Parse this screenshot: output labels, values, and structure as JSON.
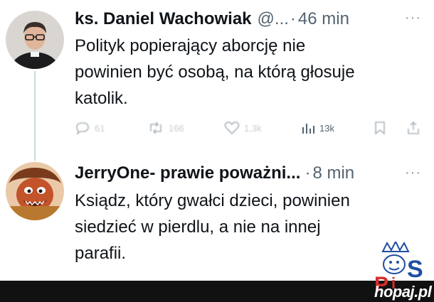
{
  "tweets": [
    {
      "display_name": "ks. Daniel Wachowiak",
      "handle": "@...",
      "separator": "·",
      "time": "46 min",
      "more_label": "···",
      "text_lines": [
        "Polityk popierający aborcję nie",
        "powinien być osobą, na którą głosuje",
        "katolik."
      ],
      "actions": {
        "replies": "61",
        "retweets": "166",
        "likes": "1,3k",
        "views": "13k"
      },
      "avatar_icon": "priest-photo"
    },
    {
      "display_name": "JerryOne- prawie poważni...",
      "separator": "·",
      "time": "8 min",
      "more_label": "···",
      "text_lines": [
        "Ksiądz, który gwałci dzieci, powinien",
        "siedzieć w pierdlu, a nie na innej",
        "parafii."
      ],
      "avatar_icon": "muppet-animal-photo"
    }
  ],
  "watermark": {
    "text": "hopaj.pl",
    "logo_icon": "pis-crown-logo"
  },
  "colors": {
    "text": "#0f1419",
    "secondary": "#536471",
    "thread_line": "#cfd9de",
    "bottom_bar": "#111111"
  }
}
